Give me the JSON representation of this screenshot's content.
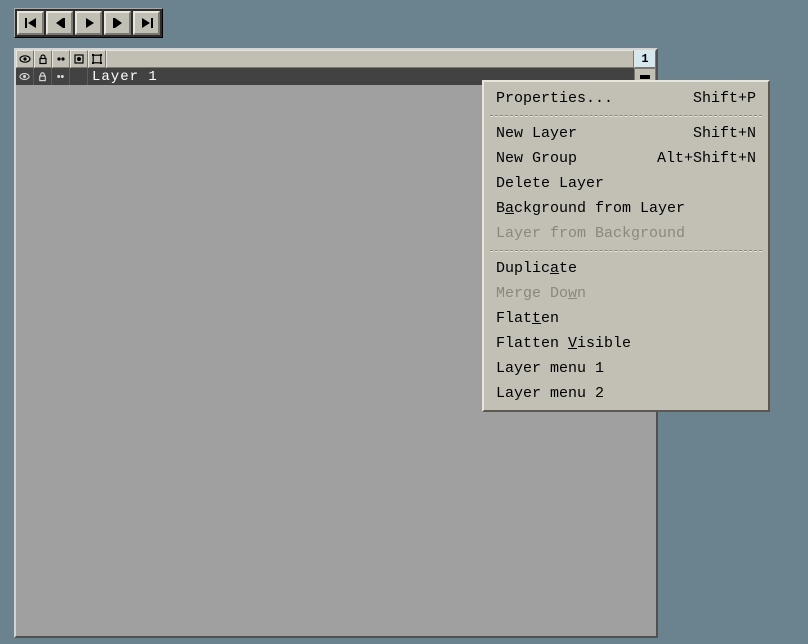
{
  "toolbar": {
    "buttons": [
      "first",
      "prev",
      "play",
      "next",
      "last"
    ]
  },
  "layers_header": {
    "cols": [
      "visible",
      "lock",
      "linked",
      "mask",
      "bounds"
    ],
    "frame_label": "1"
  },
  "layer": {
    "name": "Layer 1"
  },
  "menu": [
    {
      "kind": "item",
      "label": "Properties...",
      "shortcut": "Shift+P",
      "enabled": true,
      "u": -1
    },
    {
      "kind": "sep"
    },
    {
      "kind": "item",
      "label": "New Layer",
      "shortcut": "Shift+N",
      "enabled": true,
      "u": -1
    },
    {
      "kind": "item",
      "label": "New Group",
      "shortcut": "Alt+Shift+N",
      "enabled": true,
      "u": -1
    },
    {
      "kind": "item",
      "label": "Delete Layer",
      "shortcut": "",
      "enabled": true,
      "u": -1
    },
    {
      "kind": "item",
      "label": "Background from Layer",
      "shortcut": "",
      "enabled": true,
      "u": 1
    },
    {
      "kind": "item",
      "label": "Layer from Background",
      "shortcut": "",
      "enabled": false,
      "u": -1
    },
    {
      "kind": "sep"
    },
    {
      "kind": "item",
      "label": "Duplicate",
      "shortcut": "",
      "enabled": true,
      "u": 6
    },
    {
      "kind": "item",
      "label": "Merge Down",
      "shortcut": "",
      "enabled": false,
      "u": 8
    },
    {
      "kind": "item",
      "label": "Flatten",
      "shortcut": "",
      "enabled": true,
      "u": 4
    },
    {
      "kind": "item",
      "label": "Flatten Visible",
      "shortcut": "",
      "enabled": true,
      "u": 8
    },
    {
      "kind": "item",
      "label": "Layer menu 1",
      "shortcut": "",
      "enabled": true,
      "u": -1
    },
    {
      "kind": "item",
      "label": "Layer menu 2",
      "shortcut": "",
      "enabled": true,
      "u": -1
    }
  ]
}
